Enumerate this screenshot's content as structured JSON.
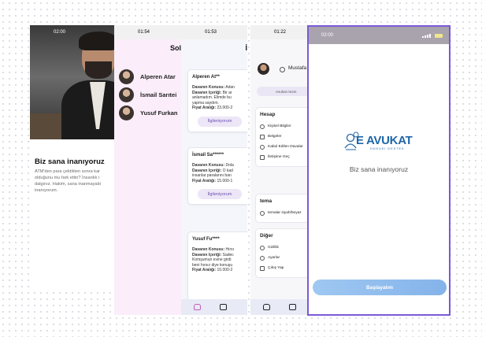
{
  "screens": {
    "welcome": {
      "time": "02:00",
      "title": "Biz sana inanıyoruz",
      "body": "ATM'den para çektikten sonra kar\nolduğunu mu fark ettin? İnsanlık i\ndalgınız. Hakim, sana inanmayabi\ninanıyorum."
    },
    "lawyers": {
      "time": "01:54",
      "header": "Sol",
      "contacts": [
        {
          "name": "Alperen Atar"
        },
        {
          "name": "İsmail Sarıtei"
        },
        {
          "name": "Yusuf Furkan"
        }
      ]
    },
    "cases": {
      "time": "01:53",
      "header": "İ",
      "cards": [
        {
          "name": "Alperen At**",
          "topic_label": "Davanın Konusu:",
          "topic": "Adan",
          "content_label": "Davanın İçeriği:",
          "content": "Bir ar",
          "extra1": "anlamadım. Elimde bu",
          "extra2": "yapma saydım.",
          "price_label": "Fiyat Aralığı:",
          "price": "23.000-2",
          "button": "İlgileniyorum"
        },
        {
          "name": "İsmail Sa******",
          "topic_label": "Davanın Konusu:",
          "topic": "Dola",
          "content_label": "Davanın İçeriği:",
          "content": "O kad",
          "extra1": "insanlar paralarını ban",
          "extra2": "",
          "price_label": "Fiyat Aralığı:",
          "price": "15.000-1",
          "button": "İlgileniyorum"
        },
        {
          "name": "Yusuf Fu****",
          "topic_label": "Davanın Konusu:",
          "topic": "Hırsı",
          "content_label": "Davanın İçeriği:",
          "content": "Sadec",
          "extra1": "Komşumun evine girdi",
          "extra2": "beni hırsız diye konuşu",
          "price_label": "Fiyat Aralığı:",
          "price": "10.000-2",
          "button": ""
        }
      ]
    },
    "profile": {
      "time": "01:22",
      "name": "Mustafa",
      "button": "Avukat mısın",
      "sections": [
        {
          "title": "Hesap",
          "items": [
            "Kişisel Bilgiler",
            "Belgeler",
            "Kabul Edilen Davalar",
            "İletişime Geç"
          ]
        },
        {
          "title": "tema",
          "items": [
            "temalar siyah/beyaz"
          ]
        },
        {
          "title": "Diğer",
          "items": [
            "Gizlilik",
            "Ayarlar",
            "Çıkış Yap"
          ]
        }
      ]
    },
    "splash": {
      "time": "02:00",
      "logo_text": "E AVUKAT",
      "logo_sub": "HUKUKI DESTEK",
      "tagline": "Biz sana inanıyoruz",
      "button": "Başlayalım"
    }
  },
  "colors": {
    "accent": "#7b5ad6",
    "brand_blue": "#1f66a8",
    "button_gradient_start": "#9fc8f2",
    "button_gradient_end": "#84b3ea"
  }
}
